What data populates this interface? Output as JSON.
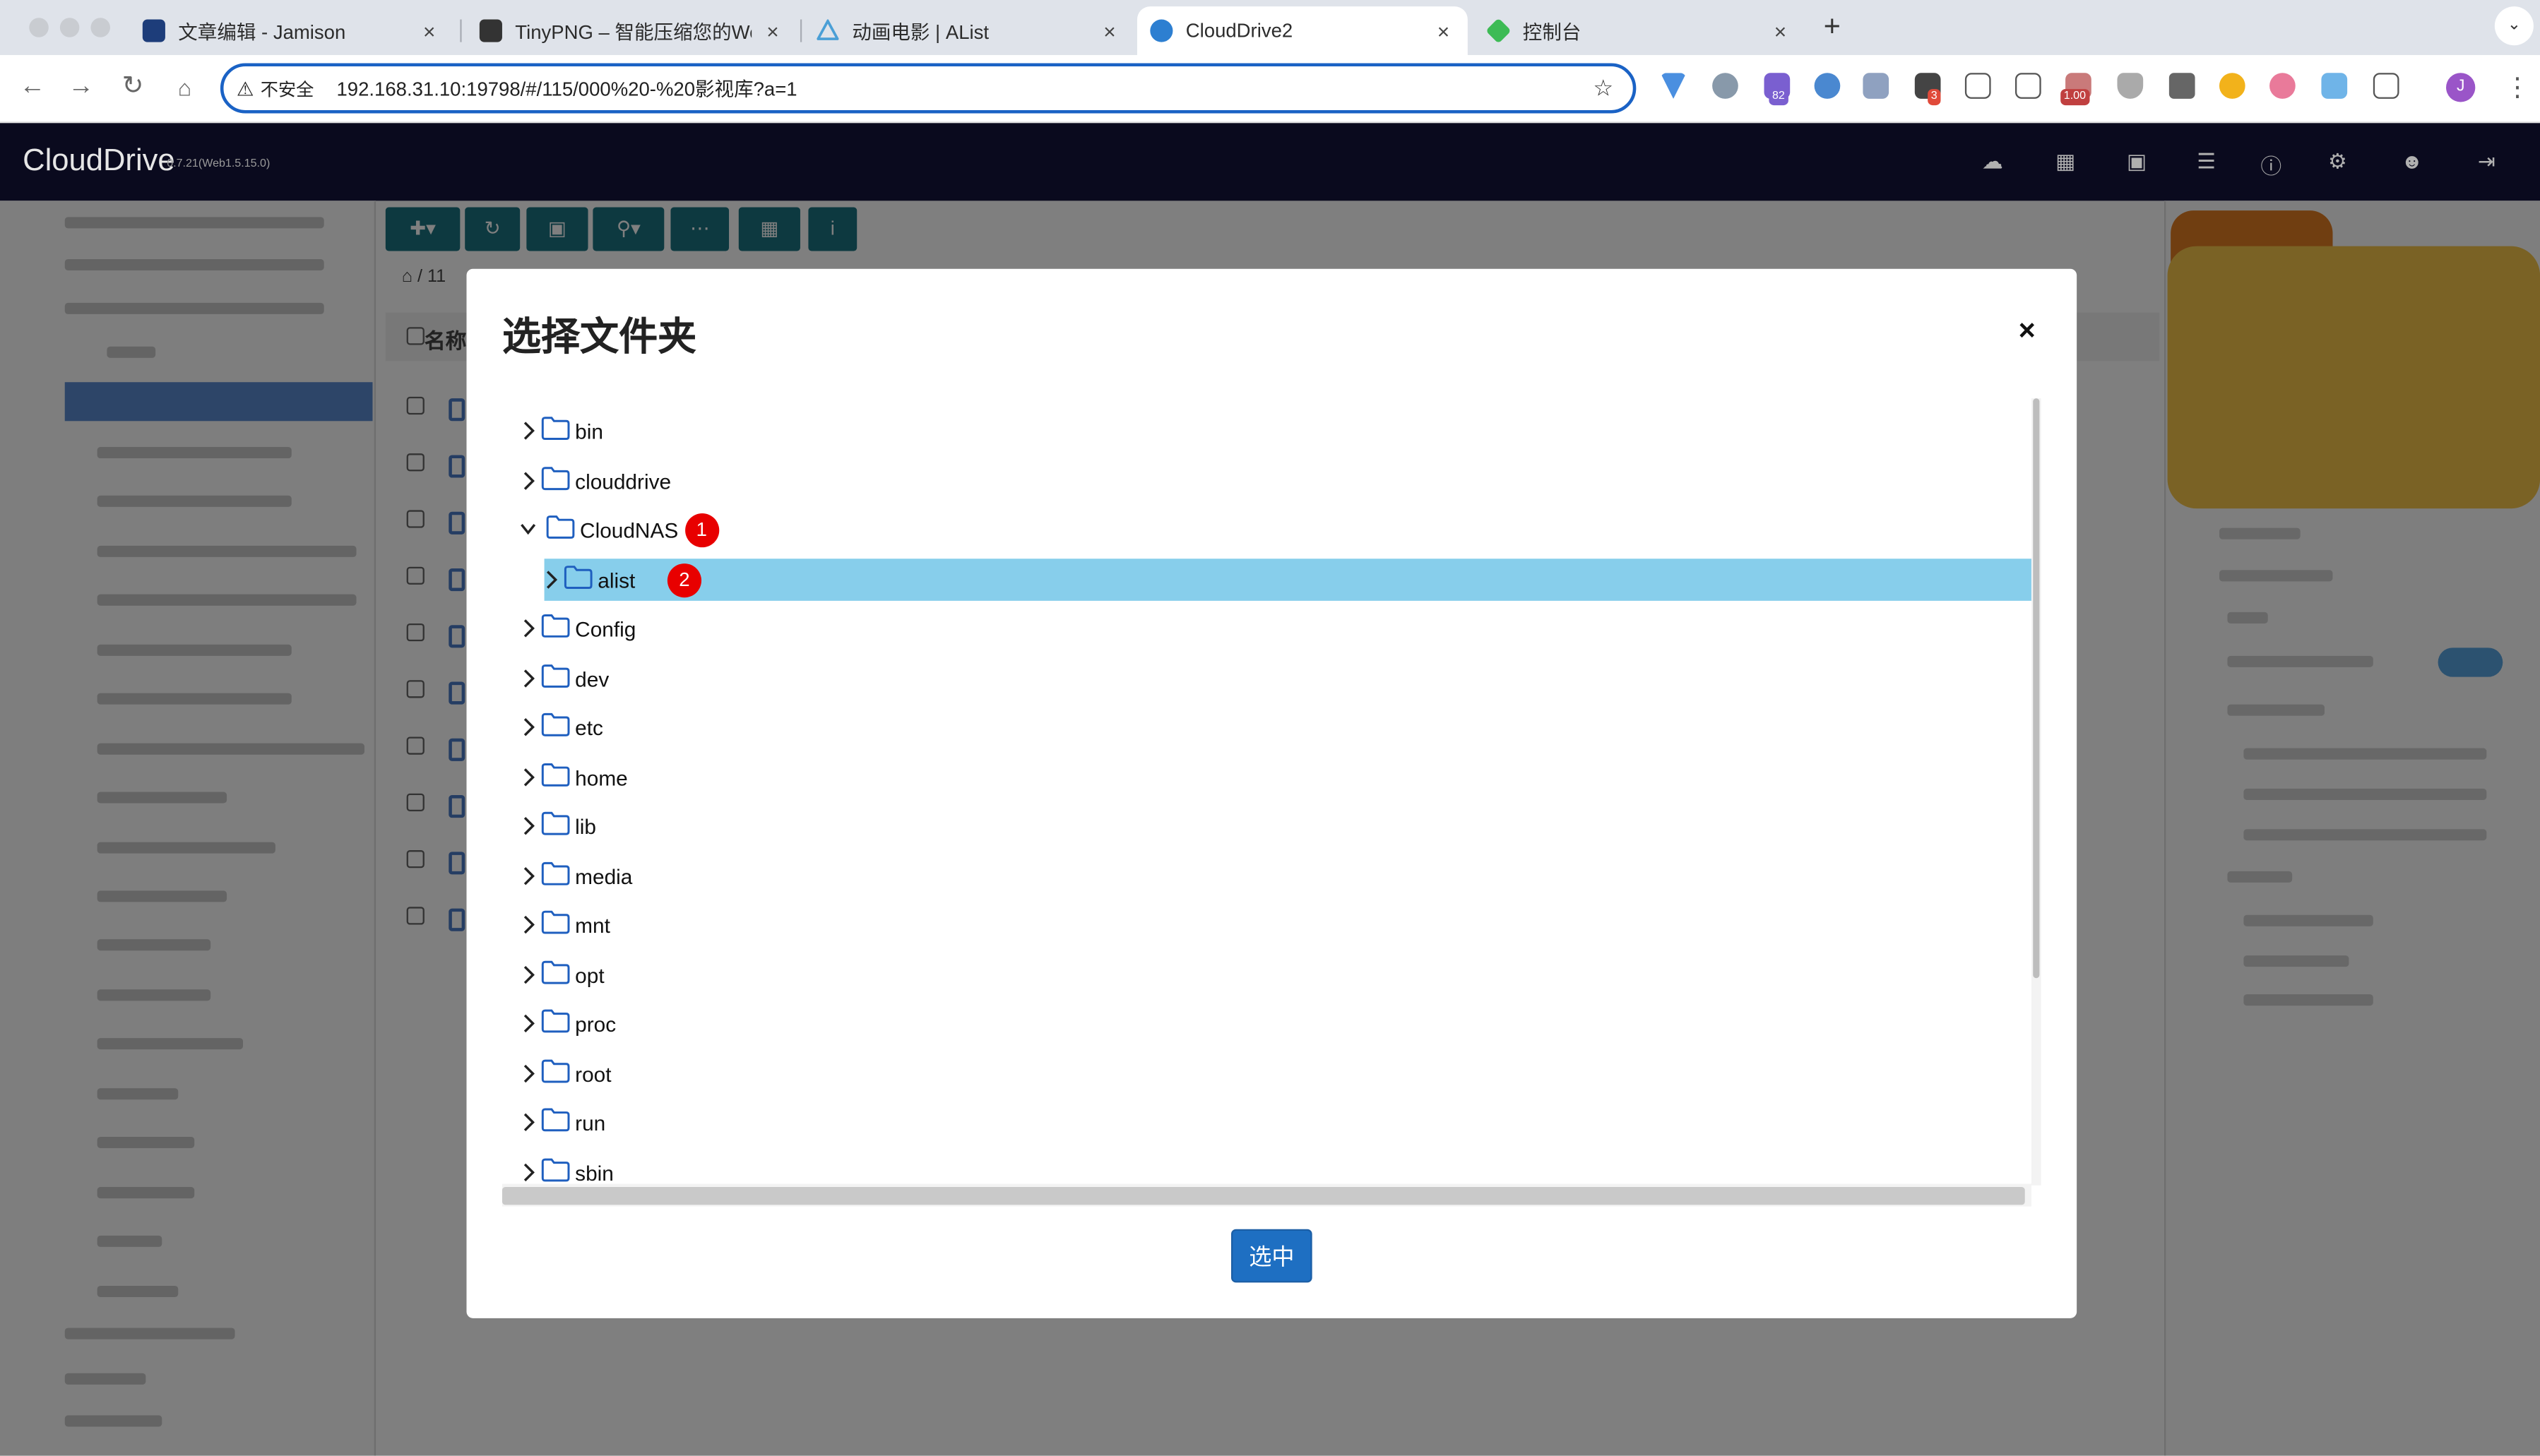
{
  "browser": {
    "tabs": [
      {
        "title": "文章编辑 - Jamison",
        "favicon_color": "#1d3d7a",
        "active": false
      },
      {
        "title": "TinyPNG – 智能压缩您的WebP",
        "favicon_color": "#333333",
        "active": false
      },
      {
        "title": "动画电影 | AList",
        "favicon_color": "#4a9fd6",
        "active": false
      },
      {
        "title": "CloudDrive2",
        "favicon_color": "#2d7fd1",
        "active": true
      },
      {
        "title": "控制台",
        "favicon_color": "#3dbb55",
        "active": false
      }
    ],
    "close_glyph": "×",
    "new_tab_glyph": "+",
    "address": {
      "security_label": "不安全",
      "url": "192.168.31.10:19798/#/115/000%20-%20影视库?a=1"
    },
    "extension_badges": {
      "ext_a": "82",
      "ext_b": "3",
      "ext_c": "1.00"
    },
    "profile_initial": "J"
  },
  "app": {
    "brand": "CloudDrive",
    "version": "0.7.21(Web1.5.15.0)",
    "header_icons": [
      "cloud-download-icon",
      "sitemap-icon",
      "desktop-icon",
      "tasks-icon",
      "info-icon",
      "settings-icon",
      "add-user-icon",
      "logout-icon"
    ],
    "toolbar_icons": [
      "add-menu-icon",
      "refresh-icon",
      "monitor-icon",
      "search-menu-icon",
      "grid-icon",
      "tree-view-icon",
      "info-icon"
    ],
    "breadcrumb": "11",
    "list_header_label": "名称"
  },
  "modal": {
    "title": "选择文件夹",
    "close_glyph": "×",
    "select_button": "选中",
    "folders": [
      {
        "name": "bin",
        "expanded": false,
        "level": 0
      },
      {
        "name": "clouddrive",
        "expanded": false,
        "level": 0
      },
      {
        "name": "CloudNAS",
        "expanded": true,
        "level": 0,
        "marker": "1"
      },
      {
        "name": "alist",
        "expanded": false,
        "level": 1,
        "selected": true,
        "marker": "2"
      },
      {
        "name": "Config",
        "expanded": false,
        "level": 0
      },
      {
        "name": "dev",
        "expanded": false,
        "level": 0
      },
      {
        "name": "etc",
        "expanded": false,
        "level": 0
      },
      {
        "name": "home",
        "expanded": false,
        "level": 0
      },
      {
        "name": "lib",
        "expanded": false,
        "level": 0
      },
      {
        "name": "media",
        "expanded": false,
        "level": 0
      },
      {
        "name": "mnt",
        "expanded": false,
        "level": 0
      },
      {
        "name": "opt",
        "expanded": false,
        "level": 0
      },
      {
        "name": "proc",
        "expanded": false,
        "level": 0
      },
      {
        "name": "root",
        "expanded": false,
        "level": 0
      },
      {
        "name": "run",
        "expanded": false,
        "level": 0
      },
      {
        "name": "sbin",
        "expanded": false,
        "level": 0
      }
    ]
  },
  "colors": {
    "selected_row": "#87ceeb",
    "marker": "#e80000",
    "primary_button": "#1e6fc2",
    "folder_stroke": "#1f5fbf"
  }
}
